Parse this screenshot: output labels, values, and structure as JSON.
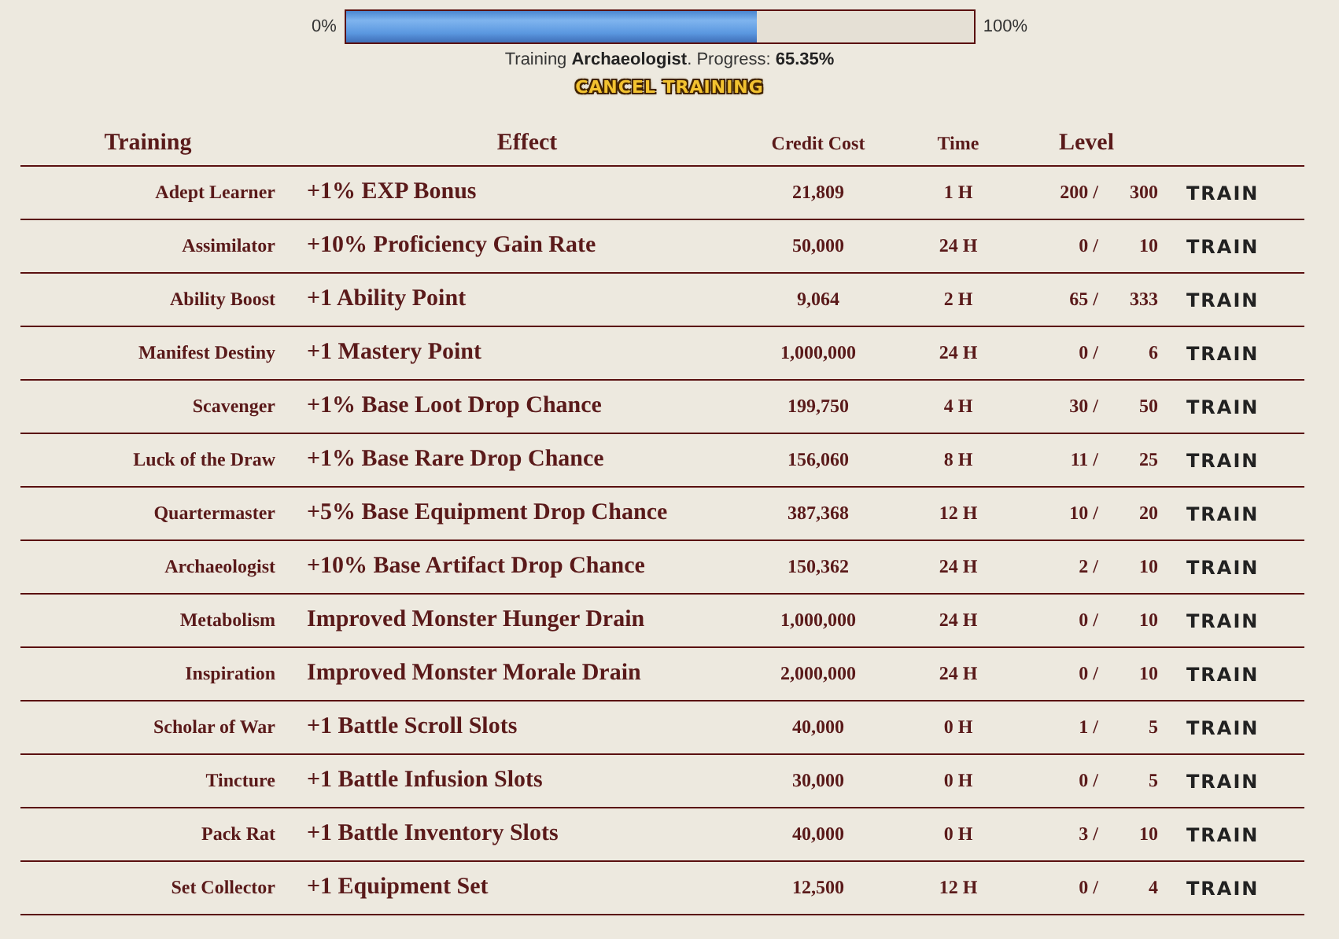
{
  "progress": {
    "min_label": "0%",
    "max_label": "100%",
    "level": 0.6535,
    "caption": "Training **Archaeologist**. Progress: **65.35%**",
    "cancel_button": "CANCEL TRAINING"
  },
  "table": {
    "columns": [
      "Training",
      "Effect",
      "Credit Cost",
      "Time",
      "Level"
    ],
    "rows": [
      {
        "training": "Adept Learner",
        "effect": "+1% EXP Bonus",
        "credit_cost": "21,809",
        "time": "1 H",
        "current": "200 /",
        "maximum": "300",
        "action": "TRAIN"
      },
      {
        "training": "Assimilator",
        "effect": "+10% Proficiency Gain Rate",
        "credit_cost": "50,000",
        "time": "24 H",
        "current": "0 /",
        "maximum": "10",
        "action": "TRAIN"
      },
      {
        "training": "Ability Boost",
        "effect": "+1 Ability Point",
        "credit_cost": "9,064",
        "time": "2 H",
        "current": "65 /",
        "maximum": "333",
        "action": "TRAIN"
      },
      {
        "training": "Manifest Destiny",
        "effect": "+1 Mastery Point",
        "credit_cost": "1,000,000",
        "time": "24 H",
        "current": "0 /",
        "maximum": "6",
        "action": "TRAIN"
      },
      {
        "training": "Scavenger",
        "effect": "+1% Base Loot Drop Chance",
        "credit_cost": "199,750",
        "time": "4 H",
        "current": "30 /",
        "maximum": "50",
        "action": "TRAIN"
      },
      {
        "training": "Luck of the Draw",
        "effect": "+1% Base Rare Drop Chance",
        "credit_cost": "156,060",
        "time": "8 H",
        "current": "11 /",
        "maximum": "25",
        "action": "TRAIN"
      },
      {
        "training": "Quartermaster",
        "effect": "+5% Base Equipment Drop Chance",
        "credit_cost": "387,368",
        "time": "12 H",
        "current": "10 /",
        "maximum": "20",
        "action": "TRAIN"
      },
      {
        "training": "Archaeologist",
        "effect": "+10% Base Artifact Drop Chance",
        "credit_cost": "150,362",
        "time": "24 H",
        "current": "2 /",
        "maximum": "10",
        "action": "TRAIN"
      },
      {
        "training": "Metabolism",
        "effect": "Improved Monster Hunger Drain",
        "credit_cost": "1,000,000",
        "time": "24 H",
        "current": "0 /",
        "maximum": "10",
        "action": "TRAIN"
      },
      {
        "training": "Inspiration",
        "effect": "Improved Monster Morale Drain",
        "credit_cost": "2,000,000",
        "time": "24 H",
        "current": "0 /",
        "maximum": "10",
        "action": "TRAIN"
      },
      {
        "training": "Scholar of War",
        "effect": "+1 Battle Scroll Slots",
        "credit_cost": "40,000",
        "time": "0 H",
        "current": "1 /",
        "maximum": "5",
        "action": "TRAIN"
      },
      {
        "training": "Tincture",
        "effect": "+1 Battle Infusion Slots",
        "credit_cost": "30,000",
        "time": "0 H",
        "current": "0 /",
        "maximum": "5",
        "action": "TRAIN"
      },
      {
        "training": "Pack Rat",
        "effect": "+1 Battle Inventory Slots",
        "credit_cost": "40,000",
        "time": "0 H",
        "current": "3 /",
        "maximum": "10",
        "action": "TRAIN"
      },
      {
        "training": "Set Collector",
        "effect": "+1 Equipment Set",
        "credit_cost": "12,500",
        "time": "12 H",
        "current": "0 /",
        "maximum": "4",
        "action": "TRAIN"
      }
    ]
  }
}
